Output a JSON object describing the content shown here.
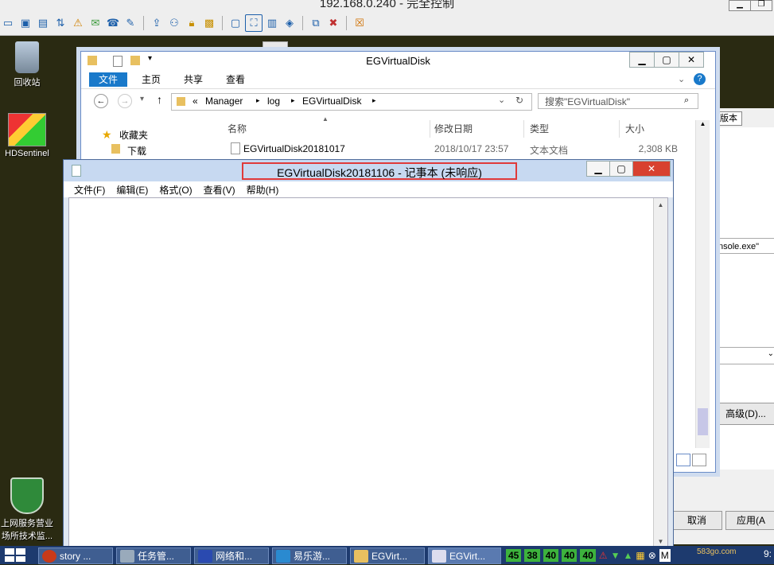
{
  "remote": {
    "title": "192.168.0.240 - 完全控制",
    "icons": [
      "monitor-icon",
      "screen-icon",
      "terminal-icon",
      "transfer-icon",
      "alert-icon",
      "chat-icon",
      "phone-icon",
      "message-icon",
      "upload-icon",
      "users-icon",
      "lock-icon",
      "lock-open-icon",
      "window-icon",
      "fullscreen-icon",
      "scale-icon",
      "fit-icon",
      "multi-screen-icon",
      "tools-icon",
      "disconnect-icon"
    ]
  },
  "desktop": {
    "recycle_bin": "回收站",
    "hdsentinel": "HDSentinel",
    "shield_line1": "上网服务营业",
    "shield_line2": "场所技术监..."
  },
  "explorer": {
    "title": "EGVirtualDisk",
    "tabs": [
      "文件",
      "主页",
      "共享",
      "查看"
    ],
    "breadcrumb": [
      "«",
      "Manager",
      "log",
      "EGVirtualDisk"
    ],
    "search_placeholder": "搜索\"EGVirtualDisk\"",
    "nav_favorites": "收藏夹",
    "nav_downloads": "下载",
    "columns": {
      "name": "名称",
      "modified": "修改日期",
      "type": "类型",
      "size": "大小"
    },
    "file_row": {
      "name": "EGVirtualDisk20181017",
      "modified": "2018/10/17 23:57",
      "type": "文本文档",
      "size": "2,308 KB"
    },
    "help": "?"
  },
  "dialog": {
    "tab_version": "版本",
    "cmd_text": "nsole.exe\"",
    "advanced": "高级(D)...",
    "cancel": "取消",
    "apply": "应用(A"
  },
  "notepad": {
    "title": "EGVirtualDisk20181106 - 记事本 (未响应)",
    "menus": [
      "文件(F)",
      "编辑(E)",
      "格式(O)",
      "查看(V)",
      "帮助(H)"
    ],
    "body": ""
  },
  "taskbar": {
    "items": [
      "story ...",
      "任务管...",
      "网络和...",
      "易乐游...",
      "EGVirt...",
      "EGVirt..."
    ],
    "tray_numbers": [
      "45",
      "38",
      "40",
      "40",
      "40"
    ],
    "tray_extra": "M",
    "watermark": "583go.com",
    "clock": "9:"
  }
}
